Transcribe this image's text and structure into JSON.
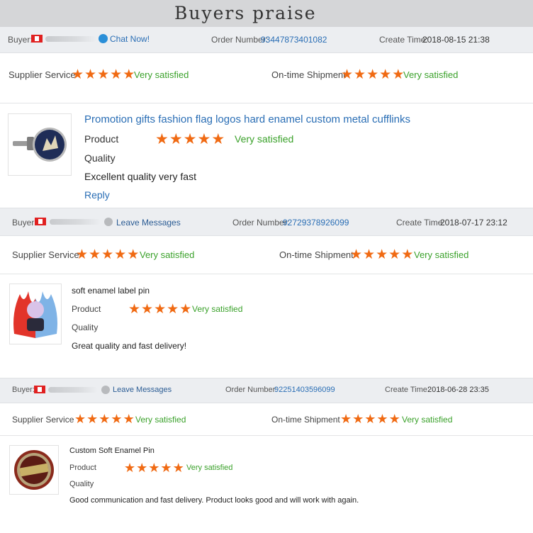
{
  "page": {
    "title": "Buyers praise"
  },
  "labels": {
    "buyer": "Buyer:",
    "order_number": "Order Number:",
    "create_time": "Create Time:",
    "supplier_service": "Supplier Service",
    "ontime_shipment": "On-time Shipment",
    "product": "Product",
    "quality": "Quality",
    "very_satisfied": "Very satisfied",
    "reply": "Reply"
  },
  "reviews": [
    {
      "action_link": "Chat Now!",
      "order_number": "93447873401082",
      "create_time": "2018-08-15 21:38",
      "supplier_rating": 5,
      "shipment_rating": 5,
      "product_rating": 5,
      "product_title": "Promotion gifts fashion flag logos hard enamel custom metal cufflinks",
      "comment": "Excellent quality very fast"
    },
    {
      "action_link": "Leave Messages",
      "order_number": "92729378926099",
      "create_time": "2018-07-17 23:12",
      "supplier_rating": 5,
      "shipment_rating": 5,
      "product_rating": 5,
      "product_title": "soft enamel label pin",
      "comment": "Great quality and fast delivery!"
    },
    {
      "action_link": "Leave Messages",
      "order_number": "92251403596099",
      "create_time": "2018-06-28 23:35",
      "supplier_rating": 5,
      "shipment_rating": 5,
      "product_rating": 5,
      "product_title": "Custom Soft Enamel Pin",
      "comment": "Good communication and fast delivery. Product looks good and will work with again."
    }
  ],
  "colors": {
    "stars": "#f06a13",
    "satisfied": "#3aa12a",
    "link": "#2a6eb5",
    "header_bg": "#eceef1"
  },
  "icons": [
    "flag-icon",
    "chat-icon",
    "message-icon",
    "star-icon"
  ]
}
